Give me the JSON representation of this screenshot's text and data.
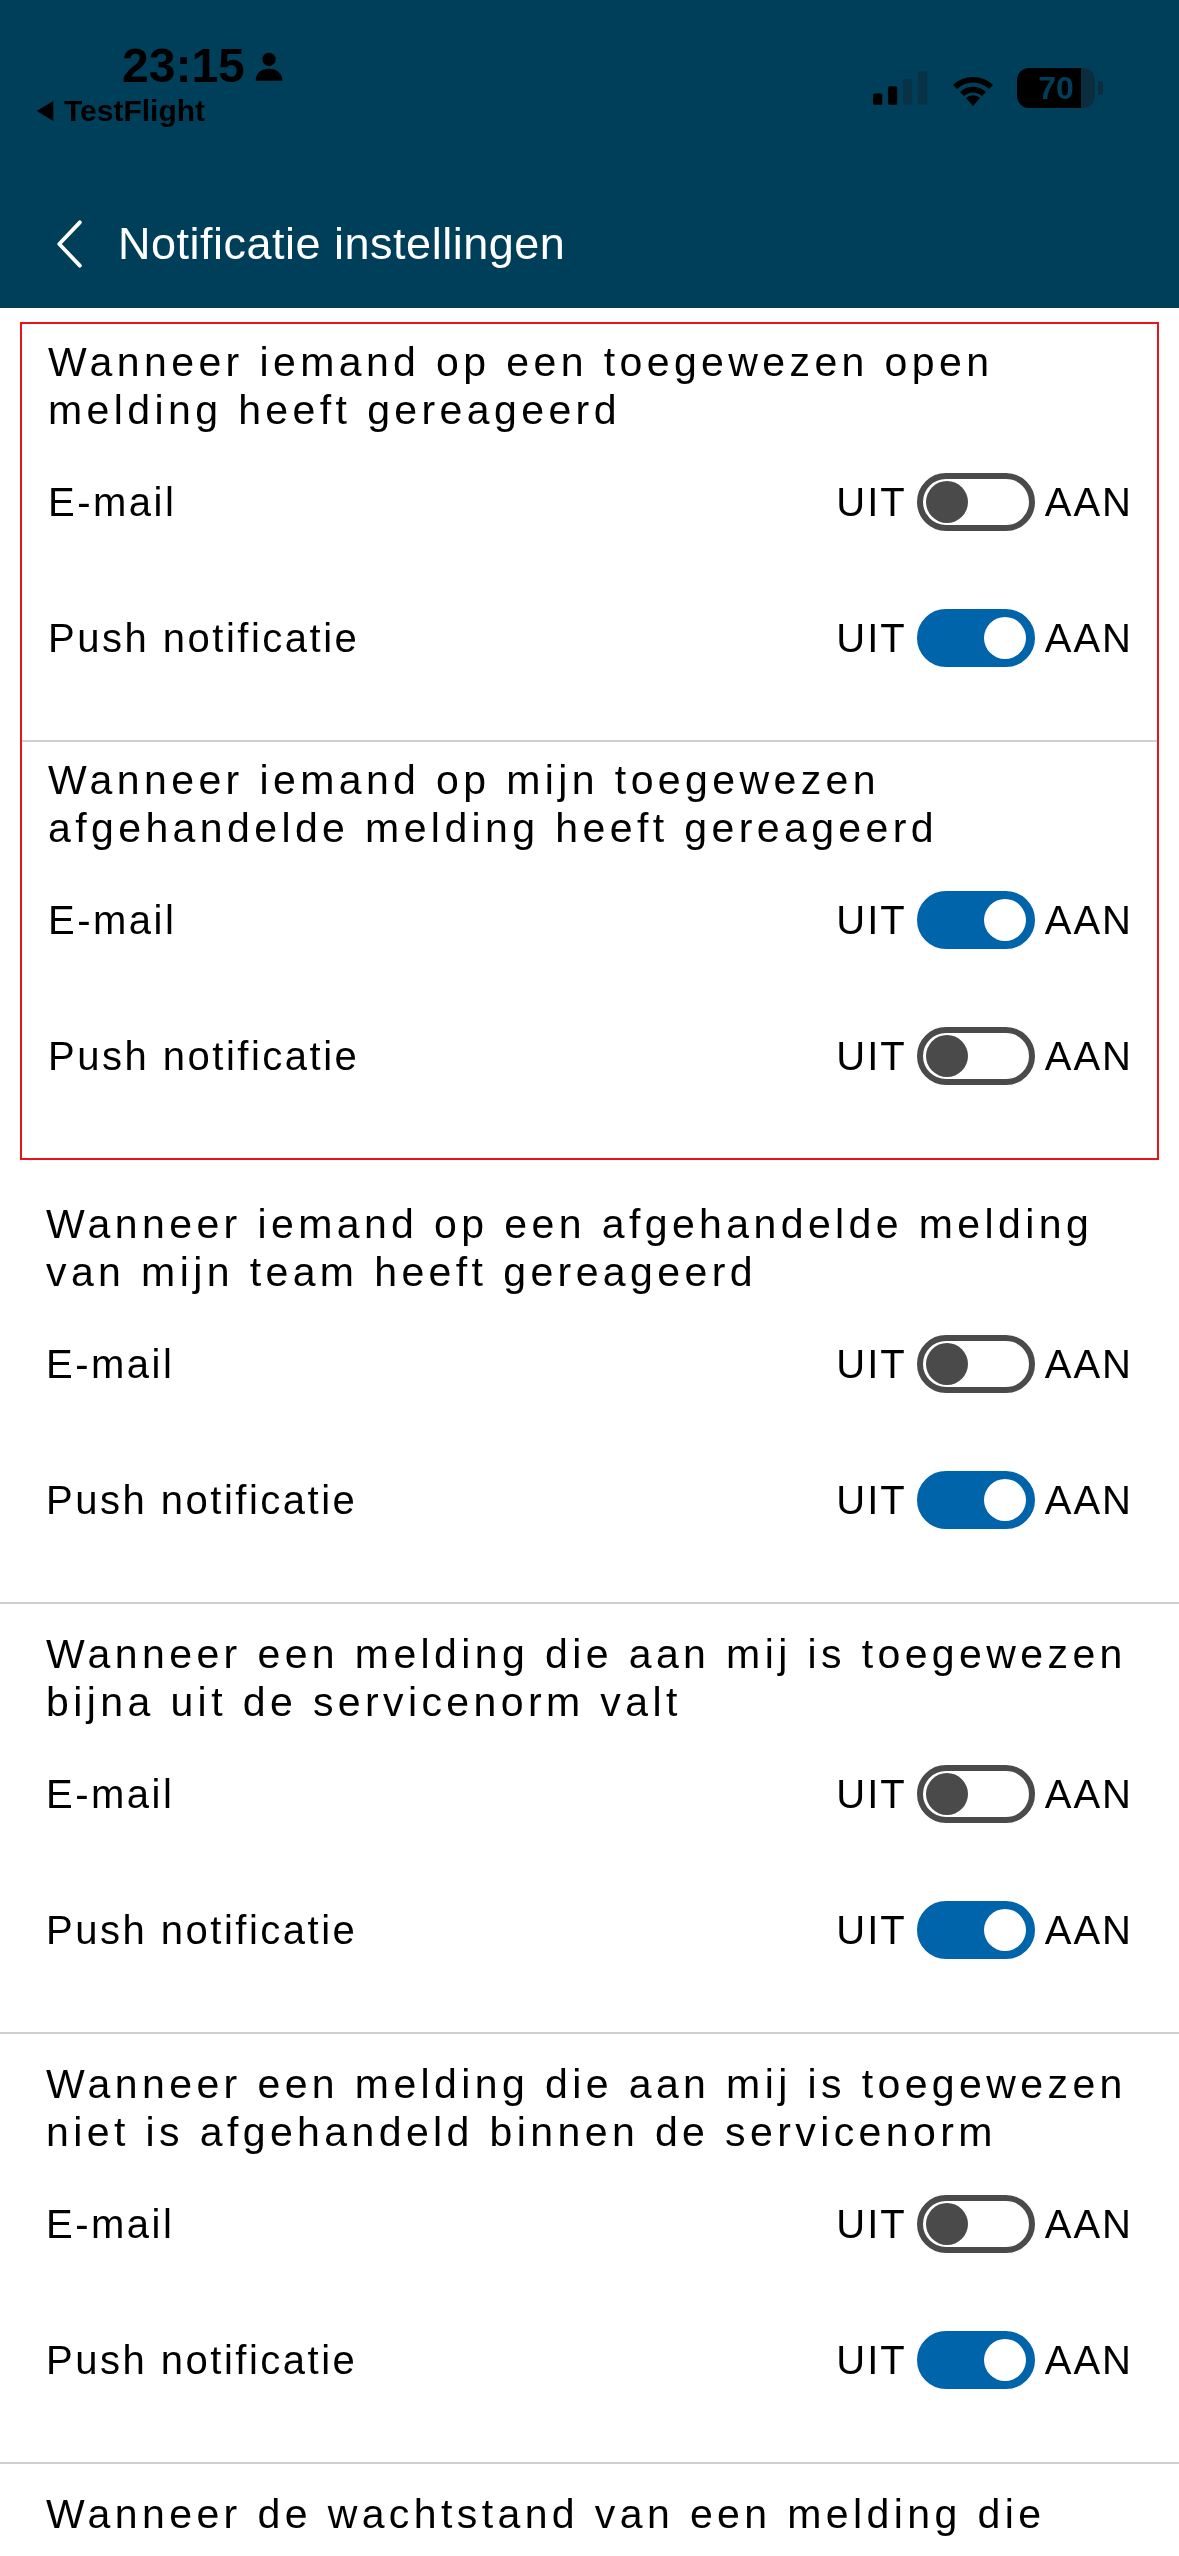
{
  "status_bar": {
    "time": "23:15",
    "back_app": "TestFlight",
    "battery": "70"
  },
  "header": {
    "title": "Notificatie instellingen"
  },
  "sections": [
    {
      "title": "Wanneer iemand op een toegewezen open melding heeft gereageerd",
      "highlighted": true,
      "rows": [
        {
          "label": "E-mail",
          "off_label": "UIT",
          "on_label": "AAN",
          "on": false
        },
        {
          "label": "Push notificatie",
          "off_label": "UIT",
          "on_label": "AAN",
          "on": true
        }
      ]
    },
    {
      "title": "Wanneer iemand op mijn toegewezen afgehandelde melding heeft gereageerd",
      "highlighted": true,
      "rows": [
        {
          "label": "E-mail",
          "off_label": "UIT",
          "on_label": "AAN",
          "on": true
        },
        {
          "label": "Push notificatie",
          "off_label": "UIT",
          "on_label": "AAN",
          "on": false
        }
      ]
    },
    {
      "title": "Wanneer iemand op een afgehandelde melding van mijn team heeft gereageerd",
      "highlighted": false,
      "rows": [
        {
          "label": "E-mail",
          "off_label": "UIT",
          "on_label": "AAN",
          "on": false
        },
        {
          "label": "Push notificatie",
          "off_label": "UIT",
          "on_label": "AAN",
          "on": true
        }
      ]
    },
    {
      "title": "Wanneer een melding die aan mij is toegewezen bijna uit de servicenorm valt",
      "highlighted": false,
      "rows": [
        {
          "label": "E-mail",
          "off_label": "UIT",
          "on_label": "AAN",
          "on": false
        },
        {
          "label": "Push notificatie",
          "off_label": "UIT",
          "on_label": "AAN",
          "on": true
        }
      ]
    },
    {
      "title": "Wanneer een melding die aan mij is toegewezen niet is afgehandeld binnen de servicenorm",
      "highlighted": false,
      "rows": [
        {
          "label": "E-mail",
          "off_label": "UIT",
          "on_label": "AAN",
          "on": false
        },
        {
          "label": "Push notificatie",
          "off_label": "UIT",
          "on_label": "AAN",
          "on": true
        }
      ]
    },
    {
      "title": "Wanneer de wachtstand van een melding die",
      "highlighted": false
    }
  ]
}
